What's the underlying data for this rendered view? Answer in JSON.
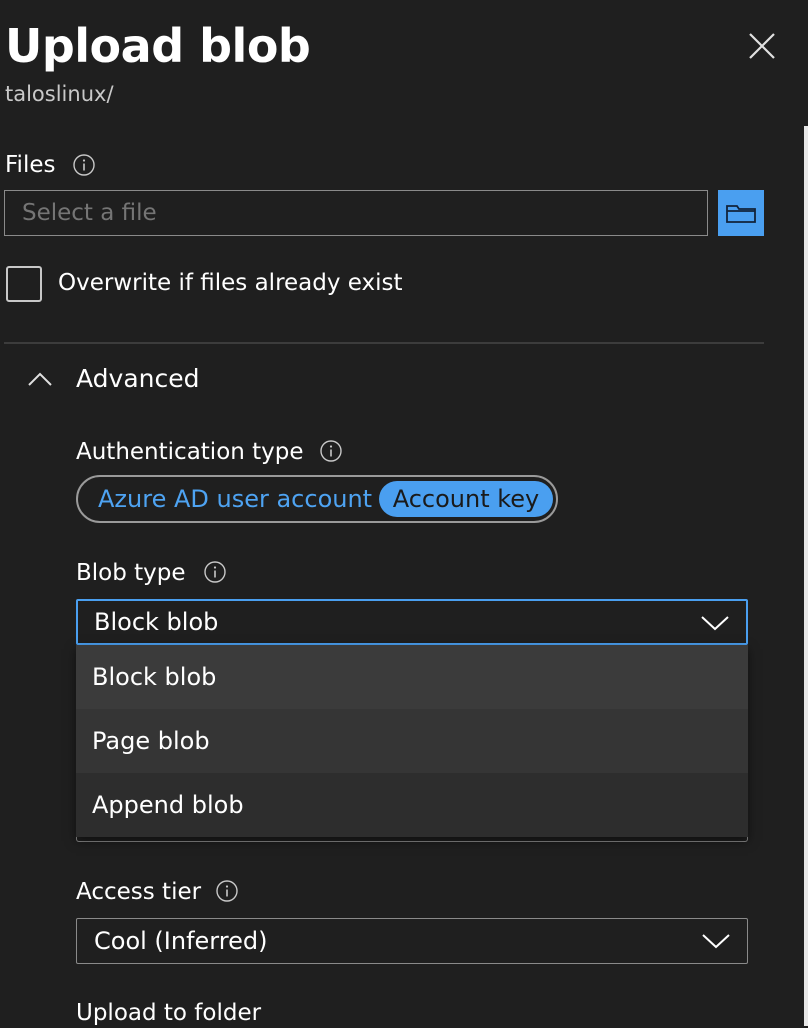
{
  "header": {
    "title": "Upload blob",
    "subtitle": "taloslinux/"
  },
  "files": {
    "label": "Files",
    "placeholder": "Select a file"
  },
  "overwrite": {
    "label": "Overwrite if files already exist",
    "checked": false
  },
  "advanced": {
    "label": "Advanced",
    "expanded": true
  },
  "auth": {
    "label": "Authentication type",
    "options": [
      "Azure AD user account",
      "Account key"
    ],
    "selected": "Account key"
  },
  "blob_type": {
    "label": "Blob type",
    "value": "Block blob",
    "options": [
      "Block blob",
      "Page blob",
      "Append blob"
    ]
  },
  "access_tier": {
    "label": "Access tier",
    "value": "Cool (Inferred)"
  },
  "upload_folder": {
    "label": "Upload to folder"
  },
  "colors": {
    "accent": "#4a9ff0",
    "background": "#1f1f1f",
    "dropdown": "#2d2d2d"
  },
  "icons": [
    "close-icon",
    "info-icon",
    "folder-icon",
    "chevron-up-icon",
    "chevron-down-icon"
  ]
}
